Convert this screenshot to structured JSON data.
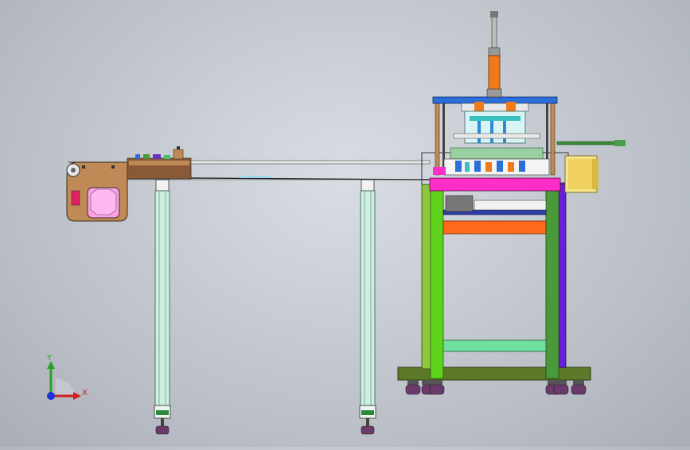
{
  "triad": {
    "x_label": "X",
    "y_label": "Y"
  },
  "colors": {
    "frame_green": "#5fd21c",
    "frame_purple": "#6a1fd6",
    "top_plate_magenta": "#ff2ec8",
    "orange_bar": "#ff6a1a",
    "cylinder_orange": "#f07a1a",
    "conveyor_body": "#c08a56",
    "base_olive": "#5d7a2a",
    "column_mint": "#cdeee0",
    "motor_yellow": "#f5e38a",
    "blue_plate": "#2d6fd8"
  }
}
